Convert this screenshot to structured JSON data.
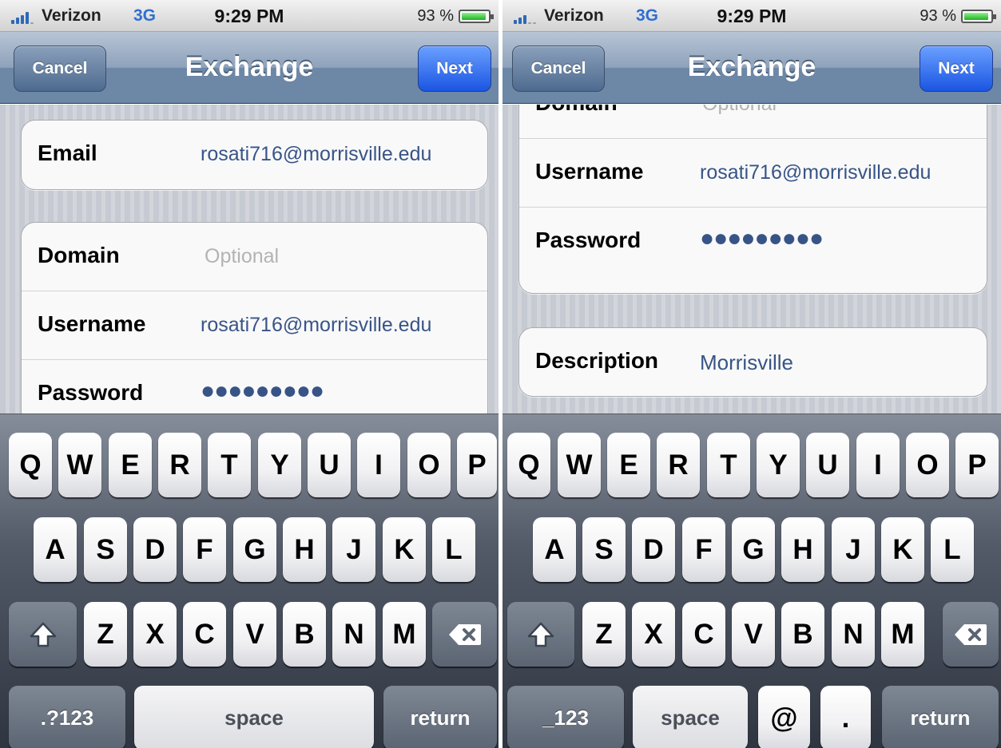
{
  "status_bar": {
    "carrier": "Verizon",
    "network": "3G",
    "time": "9:29 PM",
    "battery": "93 %",
    "battery_level": 0.93
  },
  "nav": {
    "title": "Exchange",
    "cancel": "Cancel",
    "next": "Next"
  },
  "left_form": {
    "email_label": "Email",
    "email_value": "rosati716@morrisville.edu",
    "domain_label": "Domain",
    "domain_placeholder": "Optional",
    "username_label": "Username",
    "username_value": "rosati716@morrisville.edu",
    "password_label": "Password",
    "password_value": "●●●●●●●●●"
  },
  "right_form": {
    "domain_label": "Domain",
    "domain_placeholder": "Optional",
    "username_label": "Username",
    "username_value": "rosati716@morrisville.edu",
    "password_label": "Password",
    "password_value": "●●●●●●●●●",
    "description_label": "Description",
    "description_value": "Morrisville"
  },
  "keyboard": {
    "row1": [
      "Q",
      "W",
      "E",
      "R",
      "T",
      "Y",
      "U",
      "I",
      "O",
      "P"
    ],
    "row2": [
      "A",
      "S",
      "D",
      "F",
      "G",
      "H",
      "J",
      "K",
      "L"
    ],
    "row3": [
      "Z",
      "X",
      "C",
      "V",
      "B",
      "N",
      "M"
    ],
    "shift_icon": "shift-arrow-icon",
    "delete_icon": "backspace-icon",
    "left_bottom": {
      "mode": ".?123",
      "space": "space",
      "return": "return"
    },
    "right_bottom": {
      "mode": "_123",
      "space": "space",
      "at": "@",
      "dot": ".",
      "return": "return"
    }
  }
}
